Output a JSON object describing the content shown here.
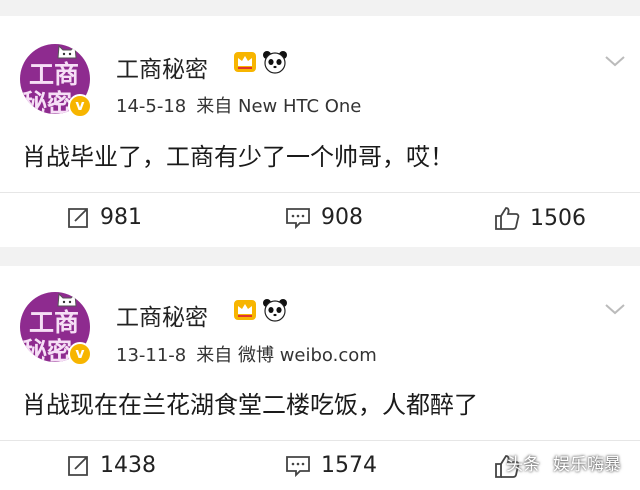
{
  "posts": [
    {
      "author": "工商秘密",
      "avatar_text_top": "工商",
      "avatar_text_bottom": "秘密",
      "verified_mark": "v",
      "date": "14-5-18",
      "source": "来自 New HTC One",
      "content": "肖战毕业了，工商有少了一个帅哥，哎！",
      "reposts": "981",
      "comments": "908",
      "likes": "1506"
    },
    {
      "author": "工商秘密",
      "avatar_text_top": "工商",
      "avatar_text_bottom": "秘密",
      "verified_mark": "v",
      "date": "13-11-8",
      "source": "来自 微博 weibo.com",
      "content": "肖战现在在兰花湖食堂二楼吃饭，人都醉了",
      "reposts": "1438",
      "comments": "1574",
      "likes": ""
    }
  ],
  "watermark": {
    "left": "头条",
    "right": "娱乐嗨暴"
  },
  "icons": {
    "avatar_badge": "verified-badge-icon",
    "crown": "crown-badge-icon",
    "panda": "panda-icon",
    "chevron": "chevron-down-icon",
    "repost": "repost-icon",
    "comment": "comment-icon",
    "like": "like-icon"
  },
  "colors": {
    "avatar_bg": "#8e2b8f",
    "verified_badge": "#f7b500",
    "page_bg": "#f2f2f2"
  }
}
